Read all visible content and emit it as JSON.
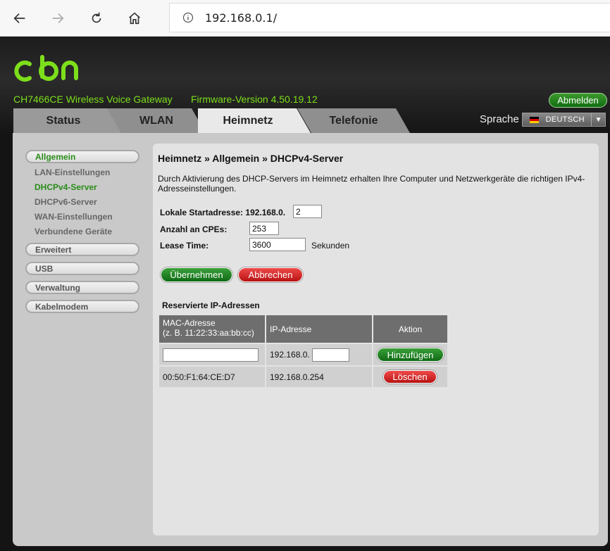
{
  "browser": {
    "url": "192.168.0.1/"
  },
  "header": {
    "model": "CH7466CE  Wireless Voice Gateway",
    "firmware": "Firmware-Version  4.50.19.12",
    "logout_label": "Abmelden",
    "language_label": "Sprache",
    "language_value": "DEUTSCH"
  },
  "tabs": [
    {
      "label": "Status"
    },
    {
      "label": "WLAN"
    },
    {
      "label": "Heimnetz",
      "active": true
    },
    {
      "label": "Telefonie"
    }
  ],
  "sidebar": {
    "sections": [
      {
        "label": "Allgemein",
        "active": true,
        "items": [
          {
            "label": "LAN-Einstellungen"
          },
          {
            "label": "DHCPv4-Server",
            "active": true
          },
          {
            "label": "DHCPv6-Server"
          },
          {
            "label": "WAN-Einstellungen"
          },
          {
            "label": "Verbundene Geräte"
          }
        ]
      },
      {
        "label": "Erweitert"
      },
      {
        "label": "USB"
      },
      {
        "label": "Verwaltung"
      },
      {
        "label": "Kabelmodem"
      }
    ]
  },
  "main": {
    "breadcrumb": "Heimnetz » Allgemein » DHCPv4-Server",
    "description": "Durch Aktivierung des DHCP-Servers im Heimnetz erhalten Ihre Computer und Netzwerkgeräte die richtigen IPv4-Adresseinstellungen.",
    "start_label": "Lokale Startadresse: 192.168.0.",
    "start_value": "2",
    "cpe_label": "Anzahl an CPEs:",
    "cpe_value": "253",
    "lease_label": "Lease Time:",
    "lease_value": "3600",
    "lease_unit": "Sekunden",
    "apply_label": "Übernehmen",
    "cancel_label": "Abbrechen",
    "reserved_title": "Reservierte IP-Adressen",
    "columns": {
      "mac": "MAC-Adresse",
      "mac_hint": "(z. B. 11:22:33:aa:bb:cc)",
      "ip": "IP-Adresse",
      "action": "Aktion"
    },
    "new_row": {
      "mac_value": "",
      "ip_prefix": "192.168.0.",
      "ip_value": "",
      "add_label": "Hinzufügen"
    },
    "rows": [
      {
        "mac": "00:50:F1:64:CE:D7",
        "ip": "192.168.0.254",
        "delete_label": "Löschen"
      }
    ]
  },
  "colors": {
    "brand_green": "#7ddf1b",
    "active_green": "#2a8c1a",
    "button_green": "#1a7a1f",
    "button_red": "#d42a2a"
  }
}
